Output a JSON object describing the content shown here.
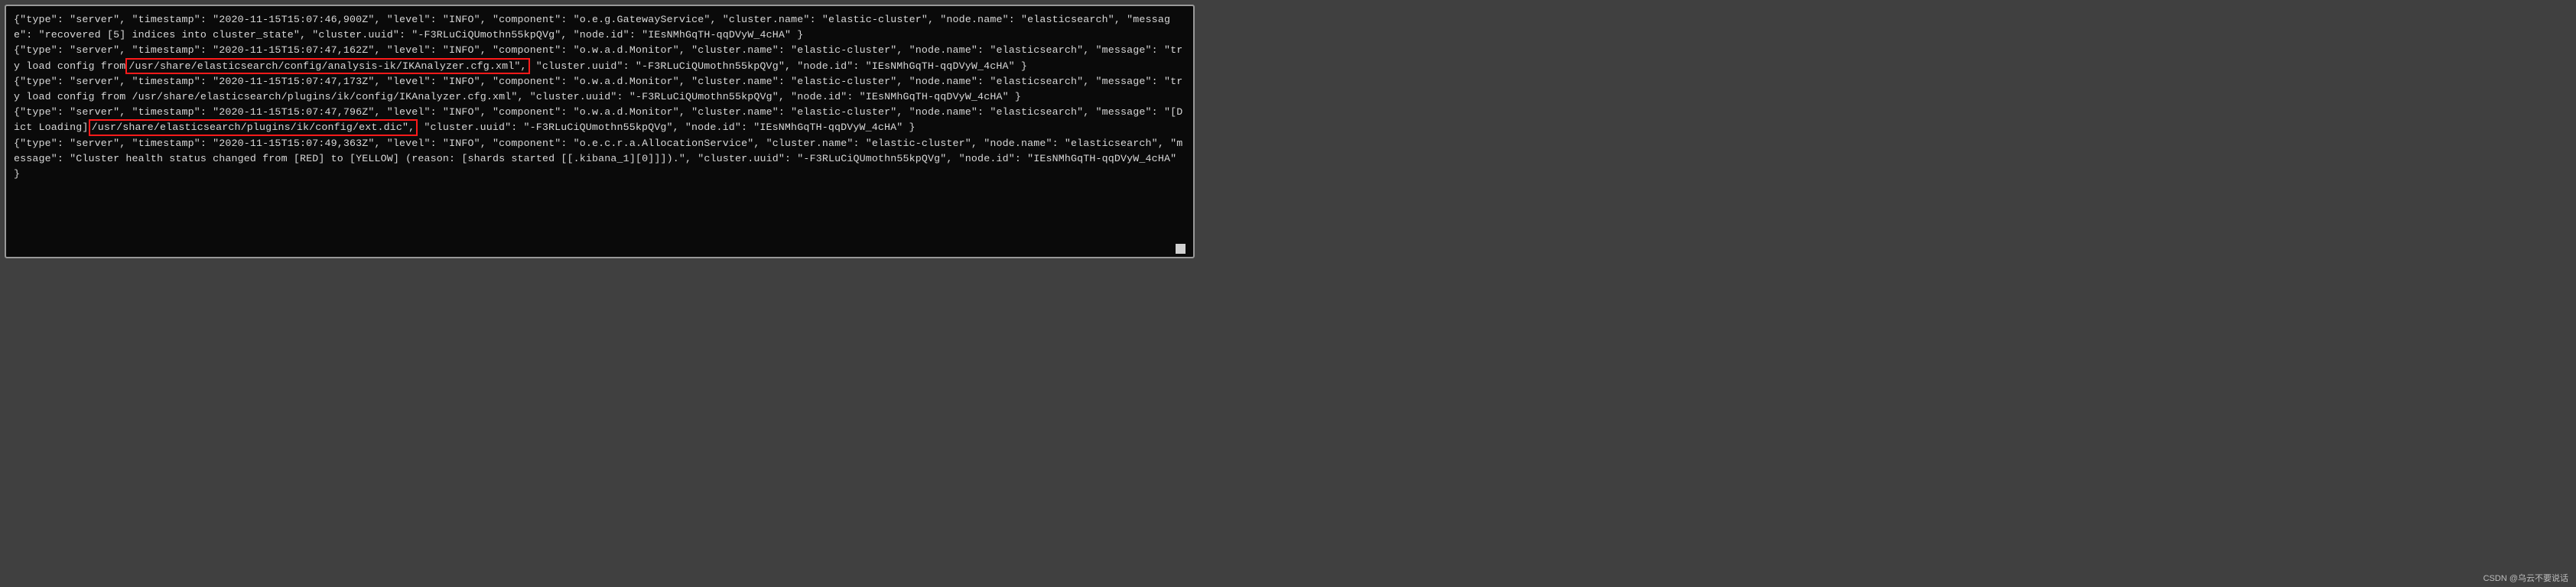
{
  "logs": {
    "line1a": "{\"type\": \"server\", \"timestamp\": \"2020-11-15T15:07:46,900Z\", \"level\": \"INFO\", \"component\": \"o.e.g.GatewayService\", \"cluster.name\": \"elastic-cluster\", \"node.name\": \"elasticsearch\", \"message\": \"recovered [5] indices into cluster_state\", \"cluster.uuid\": \"-F3RLuCiQUmothn55kpQVg\", \"node.id\": \"IEsNMhGqTH-qqDVyW_4cHA\"  }",
    "line2a": "{\"type\": \"server\", \"timestamp\": \"2020-11-15T15:07:47,162Z\", \"level\": \"INFO\", \"component\": \"o.w.a.d.Monitor\", \"cluster.name\": \"elastic-cluster\", \"node.name\": \"elasticsearch\", \"message\": \"try load config from",
    "line2_hl": " /usr/share/elasticsearch/config/analysis-ik/IKAnalyzer.cfg.xml\",",
    "line2b": " \"cluster.uuid\": \"-F3RLuCiQUmothn55kpQVg\", \"node.id\": \"IEsNMhGqTH-qqDVyW_4cHA\"  }",
    "line3": "{\"type\": \"server\", \"timestamp\": \"2020-11-15T15:07:47,173Z\", \"level\": \"INFO\", \"component\": \"o.w.a.d.Monitor\", \"cluster.name\": \"elastic-cluster\", \"node.name\": \"elasticsearch\", \"message\": \"try load config from /usr/share/elasticsearch/plugins/ik/config/IKAnalyzer.cfg.xml\", \"cluster.uuid\": \"-F3RLuCiQUmothn55kpQVg\", \"node.id\": \"IEsNMhGqTH-qqDVyW_4cHA\"  }",
    "line4a": "{\"type\": \"server\", \"timestamp\": \"2020-11-15T15:07:47,796Z\", \"level\": \"INFO\", \"component\": \"o.w.a.d.Monitor\", \"cluster.name\": \"elastic-cluster\", \"node.name\": \"elasticsearch\", \"message\": \"[Dict Loading]",
    "line4_hl": " /usr/share/elasticsearch/plugins/ik/config/ext.dic\",",
    "line4b": " \"cluster.uuid\": \"-F3RLuCiQUmothn55kpQVg\", \"node.id\": \"IEsNMhGqTH-qqDVyW_4cHA\"  }",
    "line5": "{\"type\": \"server\", \"timestamp\": \"2020-11-15T15:07:49,363Z\", \"level\": \"INFO\", \"component\": \"o.e.c.r.a.AllocationService\", \"cluster.name\": \"elastic-cluster\", \"node.name\": \"elasticsearch\", \"message\": \"Cluster health status changed from [RED] to [YELLOW] (reason: [shards started [[.kibana_1][0]]]).\", \"cluster.uuid\": \"-F3RLuCiQUmothn55kpQVg\", \"node.id\": \"IEsNMhGqTH-qqDVyW_4cHA\"  }"
  },
  "watermark": "CSDN @乌云不要说话"
}
